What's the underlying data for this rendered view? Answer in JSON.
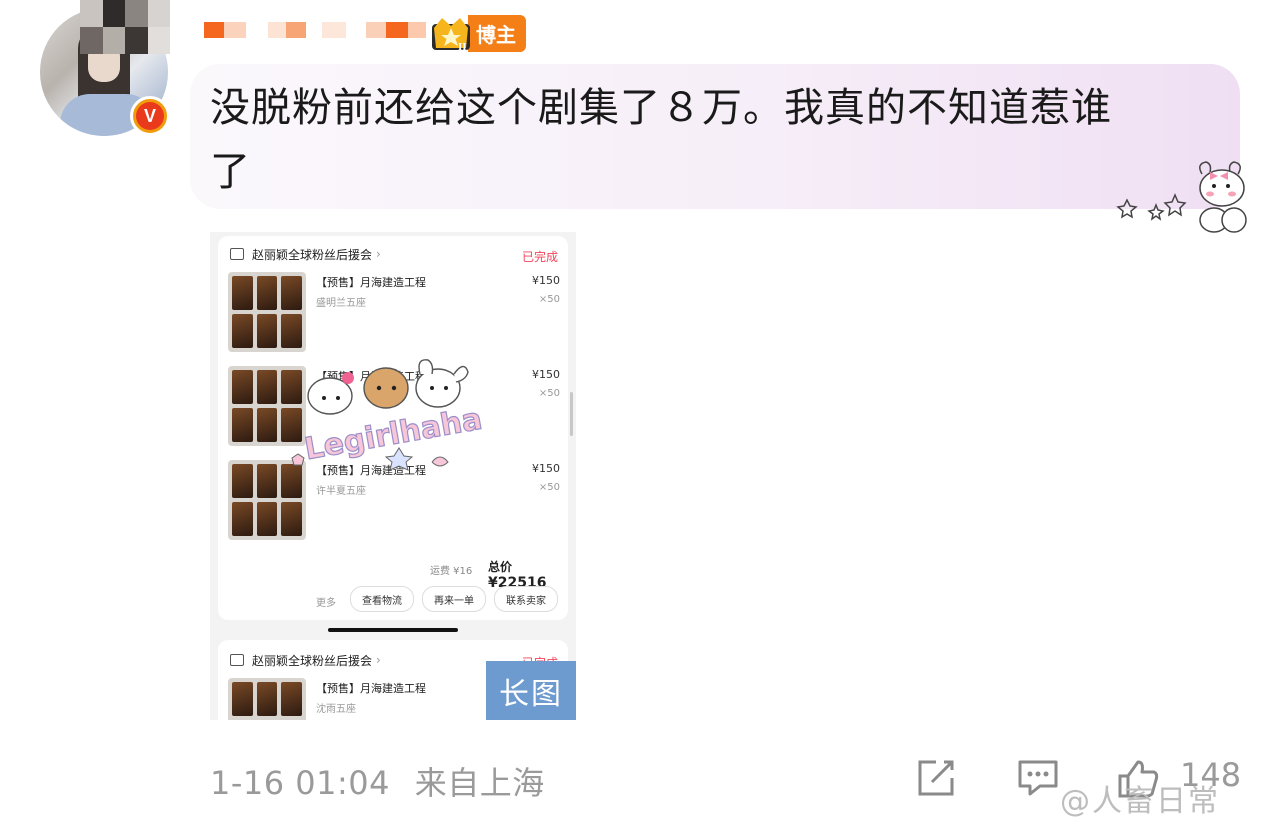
{
  "comment": {
    "user_badge_label": "博主",
    "text": "没脱粉前还给这个剧集了８万。我真的不知道惹谁了",
    "text_line1": "没脱粉前还给这个剧集了８万。我真的不知道惹谁",
    "text_line2": "了",
    "verified_badge_letter": "V"
  },
  "image": {
    "order_card_1": {
      "shop_name": "赵丽颖全球粉丝后援会",
      "status": "已完成",
      "items": [
        {
          "title": "【预售】月海建造工程",
          "sub": "盛明兰五座",
          "price": "¥150",
          "qty": "×50"
        },
        {
          "title": "【预售】月海建造工程",
          "sub": "",
          "price": "¥150",
          "qty": "×50"
        },
        {
          "title": "【预售】月海建造工程",
          "sub": "许半夏五座",
          "price": "¥150",
          "qty": "×50"
        }
      ],
      "shipping": "运费 ¥16",
      "total_label": "总价",
      "total_value": "¥22516",
      "more_label": "更多",
      "buttons": [
        "查看物流",
        "再来一单",
        "联系卖家"
      ]
    },
    "order_card_2": {
      "shop_name": "赵丽颖全球粉丝后援会",
      "status": "已完成",
      "item": {
        "title": "【预售】月海建造工程",
        "sub": "沈雨五座"
      }
    },
    "long_image_badge": "长图",
    "watermark": "Legirlhaha"
  },
  "footer": {
    "timestamp": "1-16 01:04",
    "location": "来自上海",
    "like_count": "148",
    "watermark": "@人畜日常"
  },
  "colors": {
    "badge_orange": "#f57f17",
    "status_red": "#f0465a",
    "long_badge_blue": "#6d9bcf",
    "meta_gray": "#9a9a9a"
  }
}
